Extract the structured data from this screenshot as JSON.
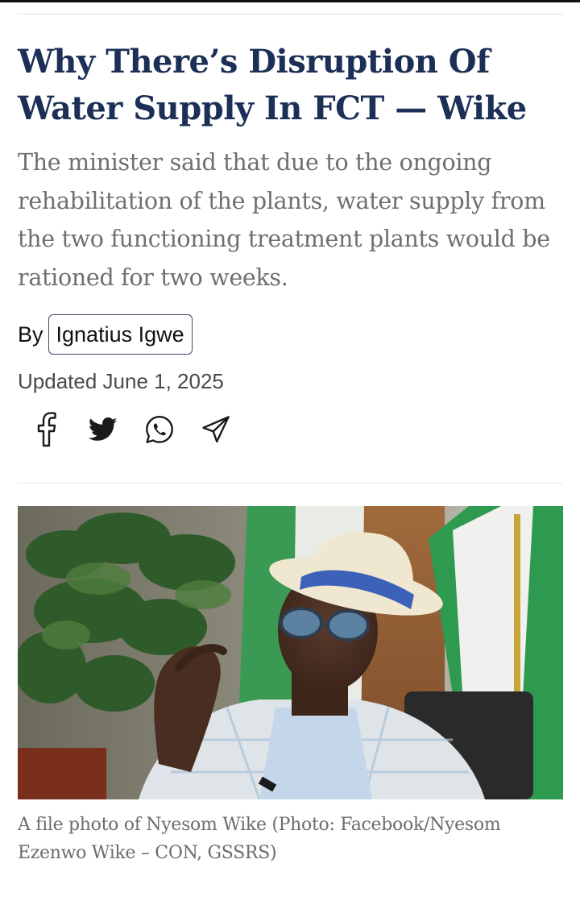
{
  "article": {
    "headline": "Why There’s Disruption Of Water Supply In FCT — Wike",
    "summary": "The minister said that due to the ongoing rehabilitation of the plants, water supply from the two functioning treatment plants would be rationed for two weeks.",
    "byline_prefix": "By",
    "author": "Ignatius Igwe",
    "updated": "Updated June 1, 2025",
    "share_icons": [
      "facebook-icon",
      "twitter-icon",
      "whatsapp-icon",
      "telegram-icon"
    ],
    "image_caption": "A file photo of Nyesom Wike (Photo: Facebook/Nyesom Ezenwo Wike – CON, GSSRS)"
  },
  "colors": {
    "headline": "#1b2f57",
    "summary": "#6f6f6f",
    "hat_band": "#3b62b8",
    "flag_green": "#2e9a4f"
  }
}
